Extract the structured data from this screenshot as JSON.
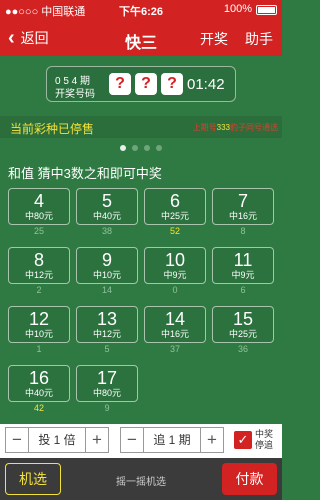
{
  "status_bar": {
    "carrier": "●●○○○ 中国联通",
    "time": "下午6:26",
    "battery": "100%"
  },
  "nav": {
    "back_label": "返回",
    "title": "快三",
    "draw_label": "开奖",
    "helper_label": "助手"
  },
  "issue": {
    "number": "0 5 4 期",
    "label": "开奖号码",
    "balls": [
      "?",
      "?",
      "?"
    ],
    "countdown": "01:42"
  },
  "banner": {
    "stop_text": "当前彩种已停售",
    "marquee_pre": "上期号",
    "marquee_num": "333",
    "marquee_post": "豹子同号通选"
  },
  "rule_text": "和值 猜中3数之和即可中奖",
  "numbers": [
    {
      "num": "4",
      "prize": "中80元",
      "miss": "25",
      "hot": false
    },
    {
      "num": "5",
      "prize": "中40元",
      "miss": "38",
      "hot": false
    },
    {
      "num": "6",
      "prize": "中25元",
      "miss": "52",
      "hot": true
    },
    {
      "num": "7",
      "prize": "中16元",
      "miss": "8",
      "hot": false
    },
    {
      "num": "8",
      "prize": "中12元",
      "miss": "2",
      "hot": false
    },
    {
      "num": "9",
      "prize": "中10元",
      "miss": "14",
      "hot": false
    },
    {
      "num": "10",
      "prize": "中9元",
      "miss": "0",
      "hot": false
    },
    {
      "num": "11",
      "prize": "中9元",
      "miss": "6",
      "hot": false
    },
    {
      "num": "12",
      "prize": "中10元",
      "miss": "1",
      "hot": false
    },
    {
      "num": "13",
      "prize": "中12元",
      "miss": "5",
      "hot": false
    },
    {
      "num": "14",
      "prize": "中16元",
      "miss": "37",
      "hot": false
    },
    {
      "num": "15",
      "prize": "中25元",
      "miss": "36",
      "hot": false
    },
    {
      "num": "16",
      "prize": "中40元",
      "miss": "42",
      "hot": true
    },
    {
      "num": "17",
      "prize": "中80元",
      "miss": "9",
      "hot": false
    }
  ],
  "multiplier": {
    "minus": "−",
    "value": "投 1 倍",
    "plus": "+"
  },
  "chase": {
    "minus": "−",
    "value": "追 1 期",
    "plus": "+"
  },
  "stop_on_win": {
    "line1": "中奖",
    "line2": "停追",
    "check": "✓"
  },
  "actions": {
    "pick_label": "机选",
    "shake_hint": "摇一摇机选",
    "pay_label": "付款"
  },
  "colors": {
    "brand_red": "#d32222",
    "table_green": "#2f7a43",
    "highlight_yellow": "#f3e23a"
  }
}
